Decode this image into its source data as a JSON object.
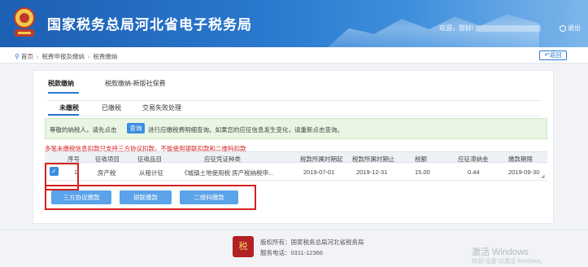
{
  "header": {
    "title": "国家税务总局河北省电子税务局",
    "welcome": "欢迎，您好!",
    "logout": "退出",
    "colors": {
      "primary": "#2a78cf",
      "header_light": "#7db6ea"
    }
  },
  "breadcrumb": {
    "home": "首页",
    "level1": "税费申报及缴纳",
    "level2": "税费缴纳",
    "back": "返回"
  },
  "tabs_primary": {
    "tab1": "税款缴纳",
    "tab2": "税款缴纳-新版社保费"
  },
  "tabs_secondary": {
    "tab1": "未缴税",
    "tab2": "已缴税",
    "tab3": "交易失败处理"
  },
  "notice": {
    "before": "尊敬的纳税人，请先点击",
    "button": "查询",
    "after": "进行应缴税费明细查询。如果您的应征信息发生变化，请重新点击查询。"
  },
  "warning": "多笔未缴税信息扣款只支持三方协议扣款，不能使用银联扣款和二维码扣款",
  "table": {
    "columns": [
      "序号",
      "征收项目",
      "征收品目",
      "应征凭证种类",
      "税款所属时期起",
      "税款所属时期止",
      "税额",
      "应征滞纳金",
      "缴款期限"
    ],
    "rows": [
      {
        "checked": "✓",
        "cells": [
          "1",
          "房产税",
          "从租计征",
          "《城镇土地使用税 房产税纳税申...",
          "2019-07-01",
          "2019-12-31",
          "15.00",
          "0.44",
          "2019-09-30"
        ]
      }
    ]
  },
  "buttons": {
    "tripartite": "三方协议缴款",
    "unionpay": "银联缴款",
    "qrcode": "二维码缴款",
    "accent": "#5aa2e9"
  },
  "footer": {
    "copyright": "版权所有：国家税务总局河北省税务局",
    "phone": "服务电话：0311-12366",
    "logo_glyph": "税"
  },
  "watermark": {
    "line1": "激活 Windows",
    "line2": "转到\"设置\"以激活 Windows。"
  },
  "highlight_color": "#d42020"
}
